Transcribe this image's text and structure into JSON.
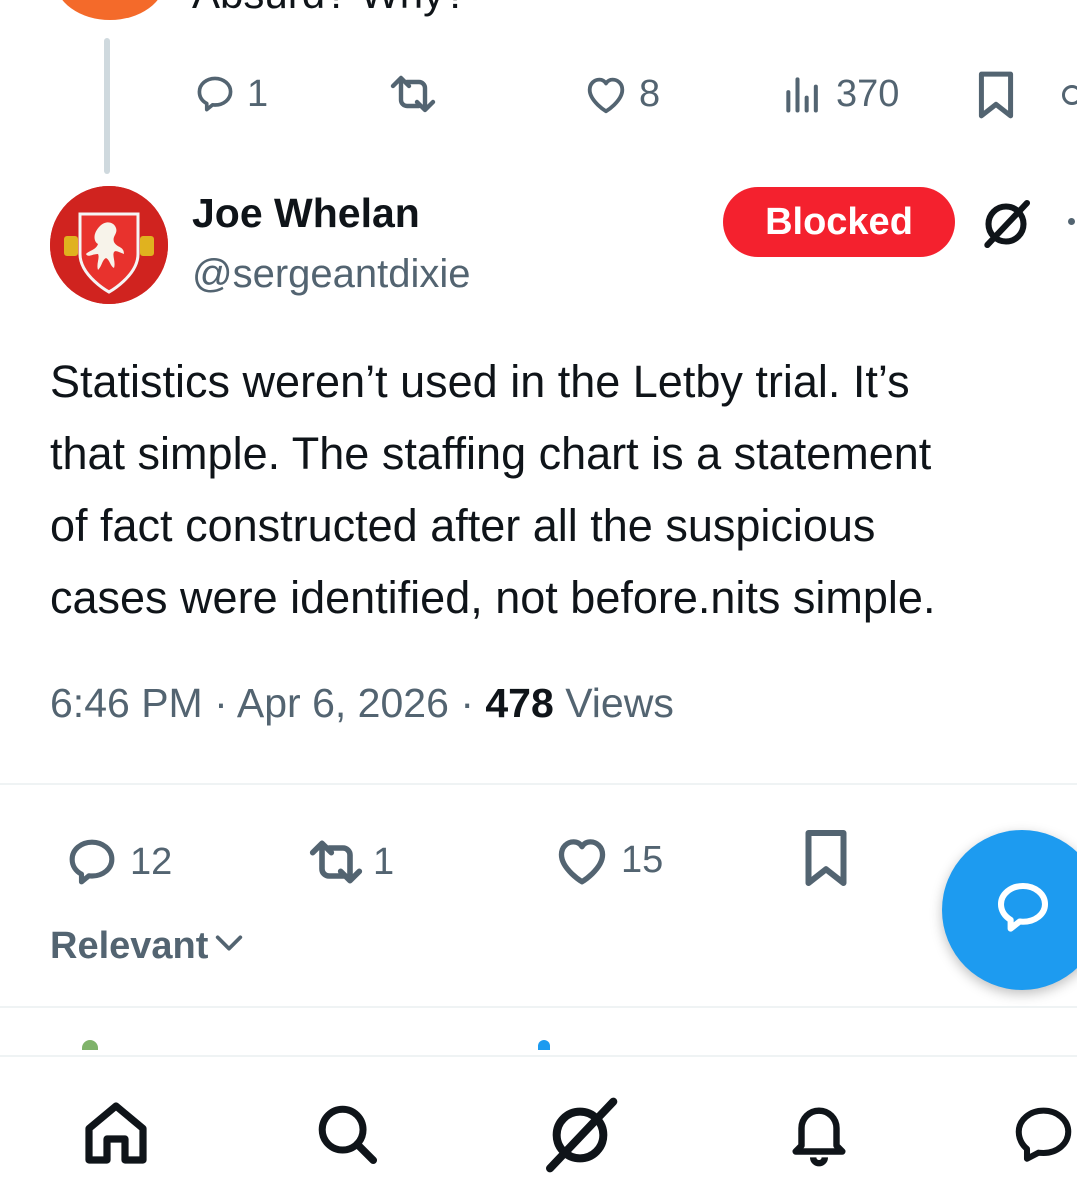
{
  "parent_tweet": {
    "text_fragment": "Absurd? Why?",
    "actions": {
      "replies": "1",
      "likes": "8",
      "views": "370"
    }
  },
  "tweet": {
    "author": {
      "display_name": "Joe Whelan",
      "handle": "@sergeantdixie"
    },
    "blocked_label": "Blocked",
    "text": "Statistics weren’t used in the Letby trial. It’s\nthat simple.  The staffing chart is a statement\nof fact constructed after all the suspicious\ncases were identified, not before.nits simple.",
    "time": "6:46 PM",
    "date": "Apr 6, 2026",
    "views_count": "478",
    "views_label": "Views",
    "actions": {
      "replies": "12",
      "reposts": "1",
      "likes": "15"
    }
  },
  "sort": {
    "label": "Relevant"
  },
  "icons": {
    "reply": "reply-icon",
    "repost": "repost-icon",
    "like": "heart-icon",
    "views": "views-icon",
    "bookmark": "bookmark-icon",
    "grok": "grok-icon",
    "compose": "compose-reply-icon",
    "nav": [
      "home-icon",
      "search-icon",
      "grok-icon",
      "notifications-icon",
      "messages-icon"
    ]
  },
  "colors": {
    "blocked": "#f4212e",
    "accent": "#1d9bf0",
    "secondary_text": "#536471",
    "parent_avatar": "#f46a2a"
  }
}
